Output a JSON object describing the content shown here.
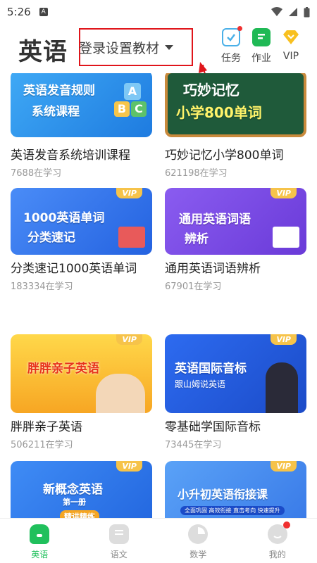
{
  "status": {
    "time": "5:26",
    "badge": "A"
  },
  "header": {
    "title": "英语",
    "textbook_label": "登录设置教材",
    "tools": [
      {
        "label": "任务",
        "icon": "task-icon"
      },
      {
        "label": "作业",
        "icon": "homework-icon"
      },
      {
        "label": "VIP",
        "icon": "vip-diamond-icon"
      }
    ]
  },
  "courses": [
    {
      "name": "英语发音系统培训课程",
      "count": "7688在学习",
      "thumb_title": [
        "英语发音规则",
        "系统课程"
      ],
      "vip": false
    },
    {
      "name": "巧妙记忆小学800单词",
      "count": "621198在学习",
      "thumb_title": [
        "巧妙记忆",
        "小学800单词"
      ],
      "vip": false
    },
    {
      "name": "分类速记1000英语单词",
      "count": "183334在学习",
      "thumb_title": [
        "1000英语单词",
        "分类速记"
      ],
      "vip": true,
      "vip_label": "VIP"
    },
    {
      "name": "通用英语词语辨析",
      "count": "67901在学习",
      "thumb_title": [
        "通用英语词语",
        "辨析"
      ],
      "vip": true,
      "vip_label": "VIP"
    },
    {
      "name": "胖胖亲子英语",
      "count": "506211在学习",
      "thumb_title": [
        "胖胖亲子英语"
      ],
      "vip": true,
      "vip_label": "VIP"
    },
    {
      "name": "零基础学国际音标",
      "count": "73445在学习",
      "thumb_title": [
        "英语国际音标",
        "跟山姆说英语"
      ],
      "vip": true,
      "vip_label": "VIP"
    },
    {
      "name": "",
      "count": "",
      "thumb_title": [
        "新概念英语",
        "第一册",
        "精讲精练"
      ],
      "vip": true,
      "vip_label": "VIP"
    },
    {
      "name": "",
      "count": "",
      "thumb_title": [
        "小升初英语衔接课",
        "全面巩固 高效衔接 直击考向 快速提升"
      ],
      "vip": true,
      "vip_label": "VIP"
    }
  ],
  "nav": [
    {
      "label": "英语",
      "icon": "home-icon",
      "active": true
    },
    {
      "label": "语文",
      "icon": "chinese-book-icon",
      "active": false
    },
    {
      "label": "数学",
      "icon": "math-icon",
      "active": false
    },
    {
      "label": "我的",
      "icon": "profile-icon",
      "active": false
    }
  ],
  "colors": {
    "accent": "#20c05c",
    "highlight_box": "#e0151b",
    "vip": "#f6c34a"
  }
}
